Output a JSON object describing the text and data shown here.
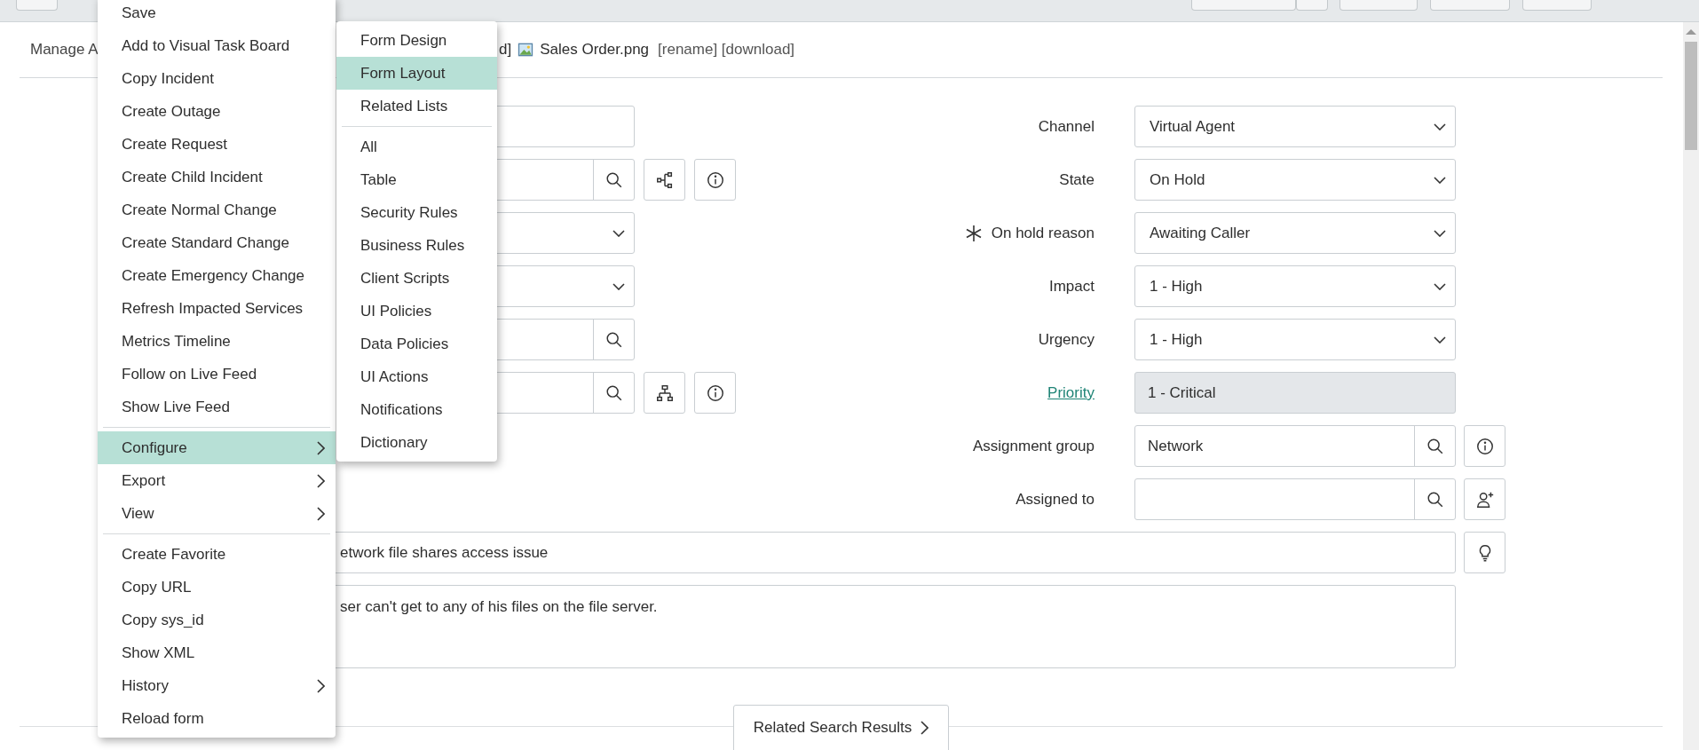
{
  "attachments": {
    "manage_link": "Manage A",
    "cut_text": "d]",
    "file_name": "Sales Order.png",
    "actions": "[rename] [download]"
  },
  "left_fields": [
    {
      "kind": "text"
    },
    {
      "kind": "lookup",
      "buttons": [
        {
          "kind": "dependency"
        },
        {
          "kind": "info"
        }
      ]
    },
    {
      "kind": "select"
    },
    {
      "kind": "select"
    },
    {
      "kind": "lookup"
    },
    {
      "kind": "lookup",
      "buttons": [
        {
          "kind": "hierarchy"
        },
        {
          "kind": "info"
        }
      ]
    }
  ],
  "right_fields": [
    {
      "label": "Channel",
      "link": false,
      "required": false,
      "kind": "select",
      "value": "Virtual Agent"
    },
    {
      "label": "State",
      "link": false,
      "required": false,
      "kind": "select",
      "value": "On Hold"
    },
    {
      "label": "On hold reason",
      "link": false,
      "required": true,
      "kind": "select",
      "value": "Awaiting Caller"
    },
    {
      "label": "Impact",
      "link": false,
      "required": false,
      "kind": "select",
      "value": "1 - High"
    },
    {
      "label": "Urgency",
      "link": false,
      "required": false,
      "kind": "select",
      "value": "1 - High"
    },
    {
      "label": "Priority",
      "link": true,
      "required": false,
      "kind": "readonly",
      "value": "1 - Critical"
    },
    {
      "label": "Assignment group",
      "link": false,
      "required": false,
      "kind": "lookup",
      "value": "Network",
      "buttons": [
        {
          "kind": "info"
        }
      ]
    },
    {
      "label": "Assigned to",
      "link": false,
      "required": false,
      "kind": "lookup",
      "buttons": [
        {
          "kind": "add-person"
        }
      ]
    }
  ],
  "short_description": {
    "value": "etwork file shares access issue"
  },
  "description": {
    "value": "ser can't get to any of his files on the file server."
  },
  "related_search": {
    "label": "Related Search Results"
  },
  "context_menu": {
    "groups": [
      {
        "items": [
          {
            "label": "Save",
            "selected": false,
            "submenu": false
          },
          {
            "label": "Add to Visual Task Board",
            "selected": false,
            "submenu": false
          },
          {
            "label": "Copy Incident",
            "selected": false,
            "submenu": false
          },
          {
            "label": "Create Outage",
            "selected": false,
            "submenu": false
          },
          {
            "label": "Create Request",
            "selected": false,
            "submenu": false
          },
          {
            "label": "Create Child Incident",
            "selected": false,
            "submenu": false
          },
          {
            "label": "Create Normal Change",
            "selected": false,
            "submenu": false
          },
          {
            "label": "Create Standard Change",
            "selected": false,
            "submenu": false
          },
          {
            "label": "Create Emergency Change",
            "selected": false,
            "submenu": false
          },
          {
            "label": "Refresh Impacted Services",
            "selected": false,
            "submenu": false
          },
          {
            "label": "Metrics Timeline",
            "selected": false,
            "submenu": false
          },
          {
            "label": "Follow on Live Feed",
            "selected": false,
            "submenu": false
          },
          {
            "label": "Show Live Feed",
            "selected": false,
            "submenu": false
          }
        ]
      },
      {
        "items": [
          {
            "label": "Configure",
            "selected": true,
            "submenu": true
          },
          {
            "label": "Export",
            "selected": false,
            "submenu": true
          },
          {
            "label": "View",
            "selected": false,
            "submenu": true
          }
        ]
      },
      {
        "items": [
          {
            "label": "Create Favorite",
            "selected": false,
            "submenu": false
          },
          {
            "label": "Copy URL",
            "selected": false,
            "submenu": false
          },
          {
            "label": "Copy sys_id",
            "selected": false,
            "submenu": false
          },
          {
            "label": "Show XML",
            "selected": false,
            "submenu": false
          },
          {
            "label": "History",
            "selected": false,
            "submenu": true
          },
          {
            "label": "Reload form",
            "selected": false,
            "submenu": false
          }
        ]
      }
    ]
  },
  "configure_submenu": {
    "groups": [
      {
        "items": [
          {
            "label": "Form Design",
            "selected": false
          },
          {
            "label": "Form Layout",
            "selected": true
          },
          {
            "label": "Related Lists",
            "selected": false
          }
        ]
      },
      {
        "items": [
          {
            "label": "All",
            "selected": false
          },
          {
            "label": "Table",
            "selected": false
          },
          {
            "label": "Security Rules",
            "selected": false
          },
          {
            "label": "Business Rules",
            "selected": false
          },
          {
            "label": "Client Scripts",
            "selected": false
          },
          {
            "label": "UI Policies",
            "selected": false
          },
          {
            "label": "Data Policies",
            "selected": false
          },
          {
            "label": "UI Actions",
            "selected": false
          },
          {
            "label": "Notifications",
            "selected": false
          },
          {
            "label": "Dictionary",
            "selected": false
          }
        ]
      }
    ]
  }
}
